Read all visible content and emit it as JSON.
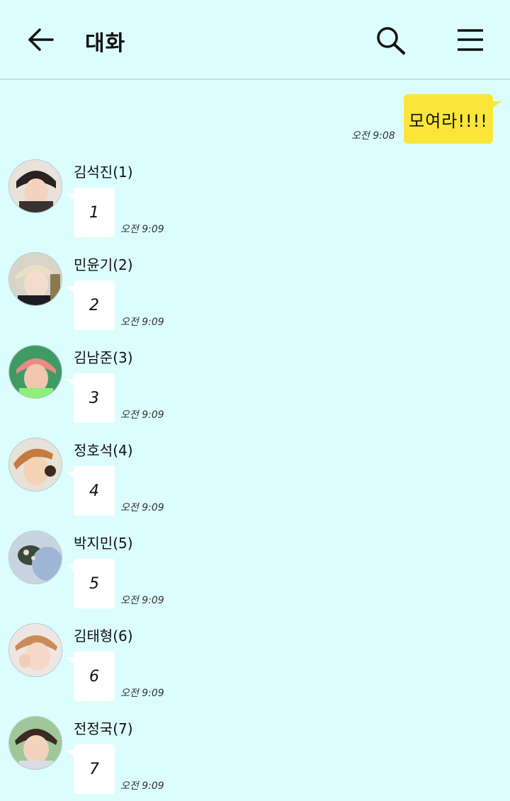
{
  "header": {
    "title": "대화",
    "icons": [
      "back-arrow-icon",
      "search-icon",
      "menu-icon"
    ]
  },
  "outgoing": {
    "text": "모여라!!!!",
    "time": "오전 9:08",
    "bubble_color": "#fae63a"
  },
  "messages": [
    {
      "sender": "김석진(1)",
      "text": "1",
      "time": "오전 9:09"
    },
    {
      "sender": "민윤기(2)",
      "text": "2",
      "time": "오전 9:09"
    },
    {
      "sender": "김남준(3)",
      "text": "3",
      "time": "오전 9:09"
    },
    {
      "sender": "정호석(4)",
      "text": "4",
      "time": "오전 9:09"
    },
    {
      "sender": "박지민(5)",
      "text": "5",
      "time": "오전 9:09"
    },
    {
      "sender": "김태형(6)",
      "text": "6",
      "time": "오전 9:09"
    },
    {
      "sender": "전정국(7)",
      "text": "7",
      "time": "오전 9:09"
    }
  ],
  "colors": {
    "background": "#dcfdfd",
    "incoming_bubble": "#ffffff"
  }
}
